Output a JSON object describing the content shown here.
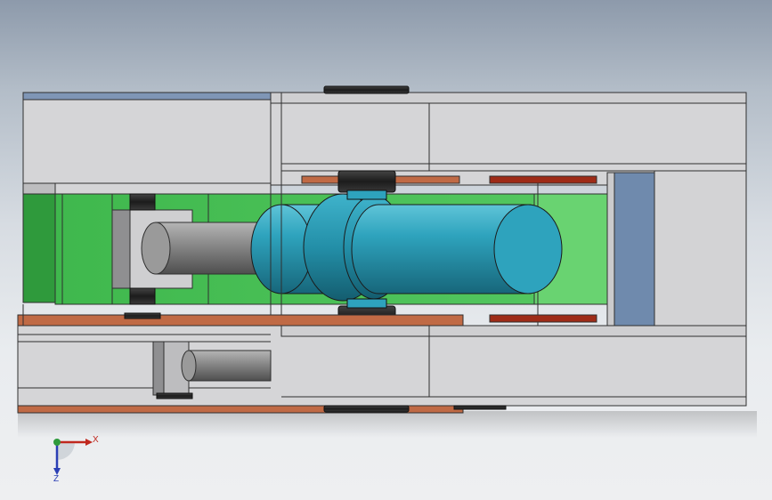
{
  "viewport": {
    "description_colors": {
      "background_top": "#8d9aab",
      "background_bottom": "#eeeff1",
      "housing_gray": "#d6d6d8",
      "housing_dark": "#c8c8ca",
      "edge": "#2f2f2f",
      "green_bright": "#4fc25c",
      "green_dark": "#2f9a3c",
      "cylinder_teal": "#2ea3bd",
      "cylinder_dark": "#1d7286",
      "rod_gray": "#8a8a8a",
      "copper": "#c06a45",
      "dark_red": "#9e2b17",
      "slate_blue": "#6f8aad",
      "bearing_black": "#2a2a2a"
    }
  },
  "triad": {
    "x_label": "X",
    "y_label": "",
    "z_label": "Z",
    "x_color": "#c0281e",
    "y_color": "#2f9a3c",
    "z_color": "#2b3fb5"
  }
}
